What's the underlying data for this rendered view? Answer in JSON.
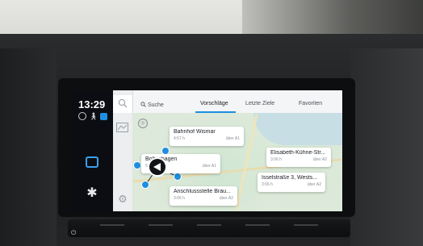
{
  "status": {
    "time": "13:29"
  },
  "tabs": [
    {
      "label": "Suche"
    },
    {
      "label": "Vorschläge"
    },
    {
      "label": "Letzte Ziele"
    },
    {
      "label": "Favoriten"
    }
  ],
  "active_tab": "Vorschläge",
  "suggestions": [
    {
      "title": "Bahnhof Wismar",
      "duration": "4:57 h",
      "via": "über A1"
    },
    {
      "title": "Boltenhagen",
      "duration": "5:02 h",
      "via": "über A1"
    },
    {
      "title": "Elisabeth-Kühne-Str...",
      "duration": "3:06 h",
      "via": "über A2"
    },
    {
      "title": "Isselstraße 3, Wests...",
      "duration": "3:06 h",
      "via": "über A2"
    },
    {
      "title": "Anschlussstelle Brau...",
      "duration": "3:06 h",
      "via": "über A2"
    }
  ],
  "icons": {
    "search": "search-icon",
    "map": "map-icon",
    "settings": "settings-icon",
    "home": "home-icon",
    "gear": "gear-icon",
    "recenter": "recenter-icon",
    "vehicle": "vehicle-position-icon"
  },
  "colors": {
    "accent": "#1e8fe0",
    "screen_bg": "#111317",
    "map_bg": "#dde9da"
  }
}
